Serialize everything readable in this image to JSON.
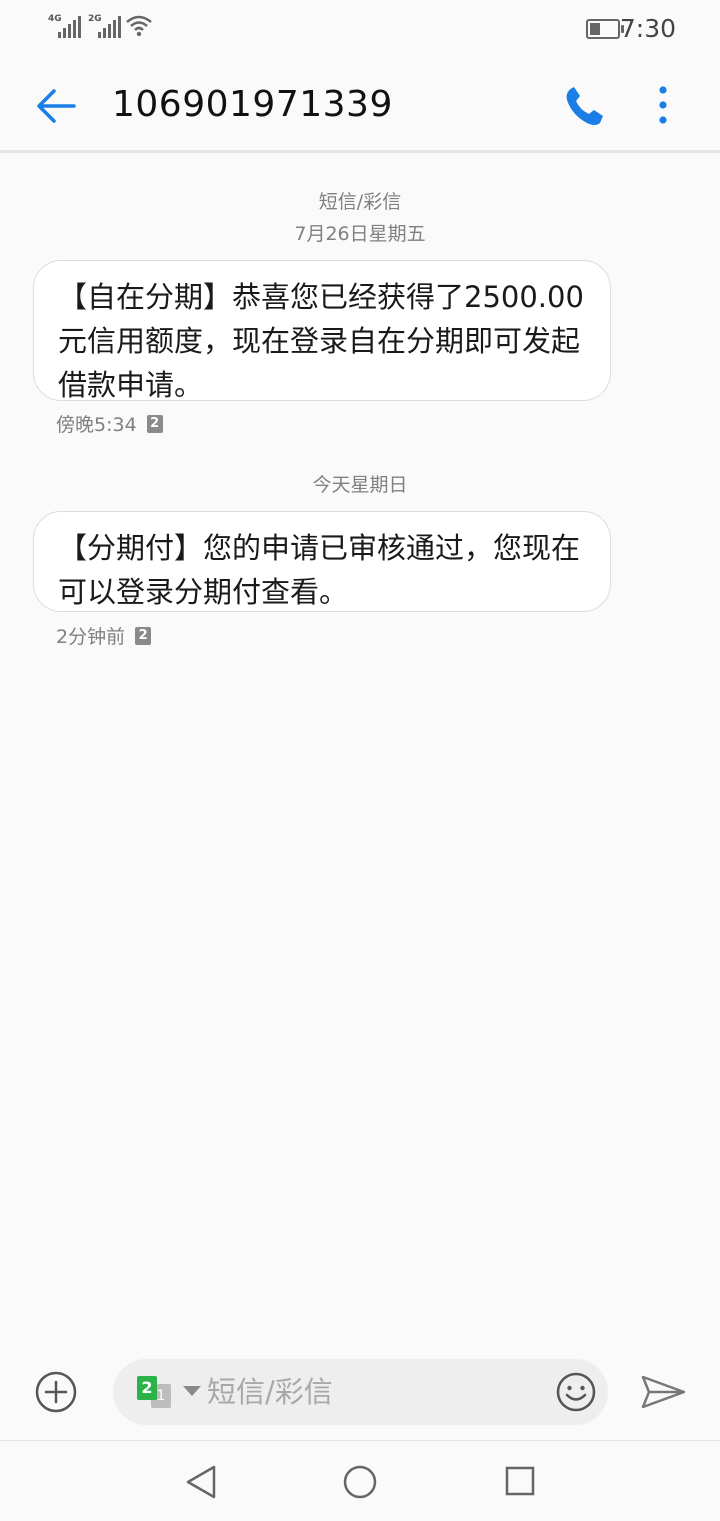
{
  "status_bar": {
    "sim1_tag": "4G",
    "sim2_tag": "2G",
    "battery_level_percent": 40,
    "time": "7:30"
  },
  "header": {
    "contact_number": "106901971339",
    "back_icon": "arrow-left-icon",
    "call_icon": "phone-icon",
    "more_icon": "more-vertical-icon",
    "accent_color": "#1a7ee6"
  },
  "thread": {
    "channel_label": "短信/彩信",
    "groups": [
      {
        "date_label": "7月26日星期五",
        "message": "【自在分期】恭喜您已经获得了2500.00元信用额度，现在登录自在分期即可发起借款申请。",
        "time": "傍晚5:34",
        "sim": "2"
      },
      {
        "date_label": "今天星期日",
        "message": "【分期付】您的申请已审核通过，您现在可以登录分期付查看。",
        "time": "2分钟前",
        "sim": "2"
      }
    ]
  },
  "composer": {
    "add_icon": "plus-circle-icon",
    "sim_primary": "2",
    "sim_secondary": "1",
    "placeholder": "短信/彩信",
    "emoji_icon": "emoji-icon",
    "send_icon": "send-icon"
  },
  "nav_bar": {
    "back_icon": "triangle-back-icon",
    "home_icon": "circle-home-icon",
    "recents_icon": "square-recents-icon"
  }
}
